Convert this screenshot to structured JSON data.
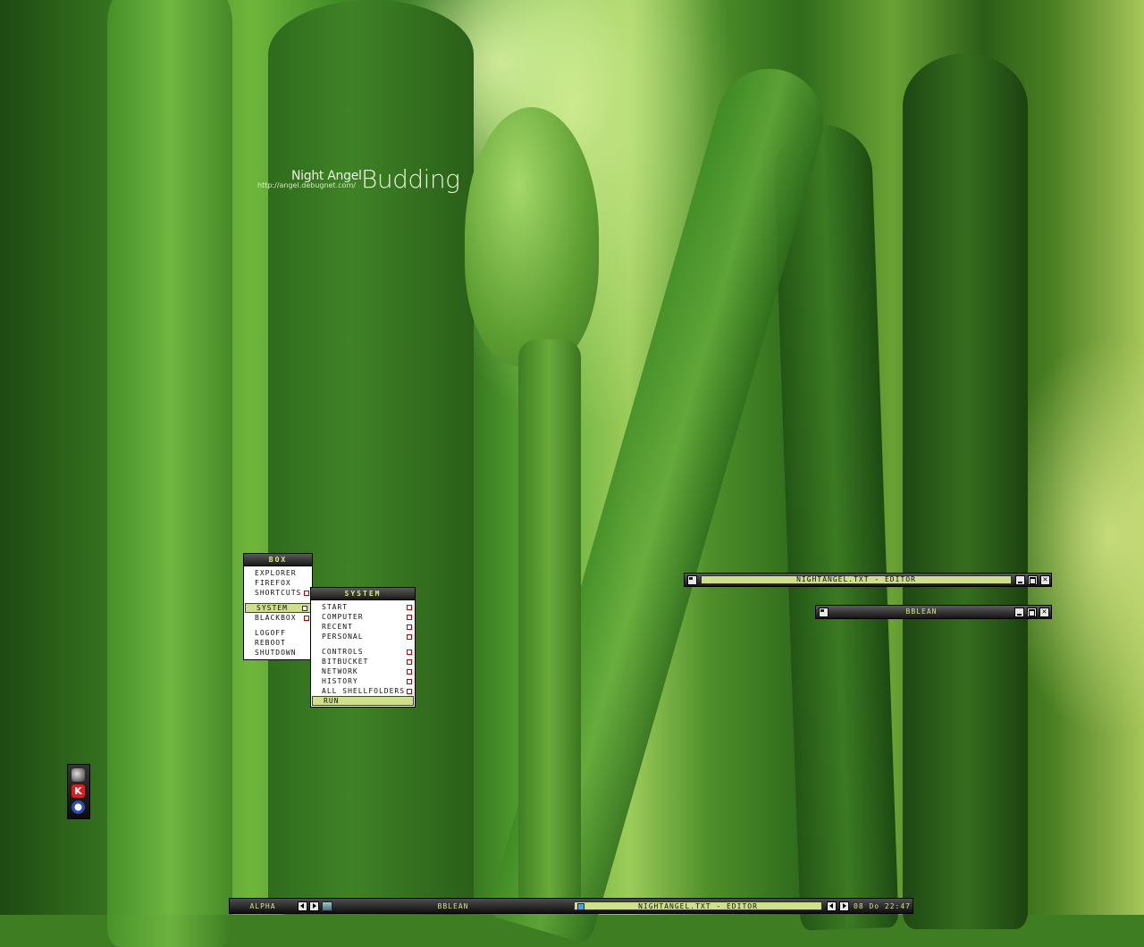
{
  "wallpaper": {
    "brand_small": "Night Angel",
    "brand_url": "http://angel.debugnet.com/",
    "brand_big": "Budding"
  },
  "root_menu": {
    "title": "BOX",
    "items": [
      {
        "label": "EXPLORER",
        "submenu": false
      },
      {
        "label": "FIREFOX",
        "submenu": false
      },
      {
        "label": "SHORTCUTS",
        "submenu": true
      },
      {
        "label": "SYSTEM",
        "submenu": true,
        "active": true
      },
      {
        "label": "BLACKBOX",
        "submenu": true
      },
      {
        "label": "LOGOFF",
        "submenu": false
      },
      {
        "label": "REBOOT",
        "submenu": false
      },
      {
        "label": "SHUTDOWN",
        "submenu": false
      }
    ]
  },
  "system_menu": {
    "title": "SYSTEM",
    "items": [
      {
        "label": "START",
        "submenu": true
      },
      {
        "label": "COMPUTER",
        "submenu": true
      },
      {
        "label": "RECENT",
        "submenu": true
      },
      {
        "label": "PERSONAL",
        "submenu": true
      },
      {
        "label": "CONTROLS",
        "submenu": true
      },
      {
        "label": "BITBUCKET",
        "submenu": true
      },
      {
        "label": "NETWORK",
        "submenu": true
      },
      {
        "label": "HISTORY",
        "submenu": true
      },
      {
        "label": "ALL SHELLFOLDERS",
        "submenu": true
      },
      {
        "label": "RUN",
        "submenu": false,
        "active": true
      }
    ]
  },
  "windows": [
    {
      "title": "NIGHTANGEL.TXT - EDITOR",
      "focused": true
    },
    {
      "title": "BBLEAN",
      "focused": false
    }
  ],
  "tray": {
    "icons": [
      "speaker-icon",
      "antivirus-icon",
      "bblean-icon"
    ]
  },
  "toolbar": {
    "workspace": "ALPHA",
    "label": "BBLEAN",
    "task": "NIGHTANGEL.TXT - EDITOR",
    "clock": "08 Do 22:47"
  },
  "colors": {
    "accent": "#cfe08c",
    "title_bar": "#1a1a1a",
    "submenu_marker": "#b00000"
  }
}
